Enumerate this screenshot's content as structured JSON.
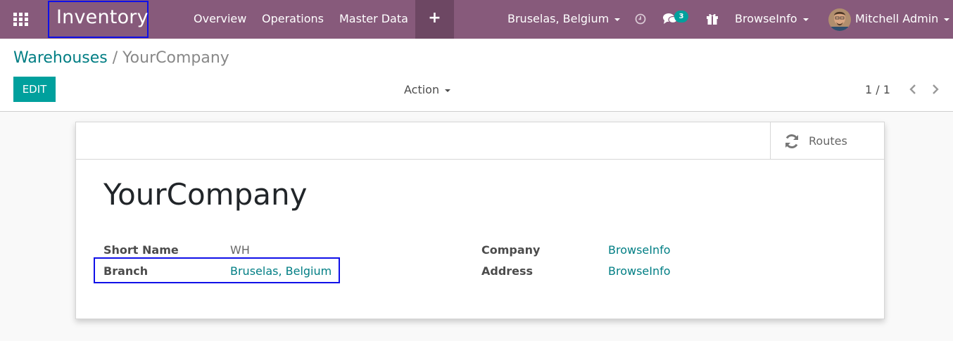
{
  "navbar": {
    "app_name": "Inventory",
    "menu": [
      "Overview",
      "Operations",
      "Master Data"
    ],
    "quick_create_label": "+",
    "branch": "Bruselas, Belgium",
    "messages_count": "3",
    "company": "BrowseInfo",
    "user": "Mitchell Admin",
    "color": "#875a7b"
  },
  "breadcrumb": {
    "parent": "Warehouses",
    "separator": "/",
    "current": "YourCompany"
  },
  "toolbar": {
    "edit_label": "EDIT",
    "action_label": "Action",
    "pager": "1 / 1"
  },
  "form": {
    "routes_label": "Routes",
    "title": "YourCompany",
    "short_name_label": "Short Name",
    "short_name_value": "WH",
    "branch_label": "Branch",
    "branch_value": "Bruselas, Belgium",
    "company_label": "Company",
    "company_value": "BrowseInfo",
    "address_label": "Address",
    "address_value": "BrowseInfo"
  },
  "colors": {
    "accent": "#00a09d",
    "link": "#017e84",
    "highlight": "#1010e8"
  },
  "icons": [
    "apps-grid-icon",
    "clock-icon",
    "chat-icon",
    "gift-icon",
    "refresh-icon",
    "chevron-left-icon",
    "chevron-right-icon"
  ]
}
